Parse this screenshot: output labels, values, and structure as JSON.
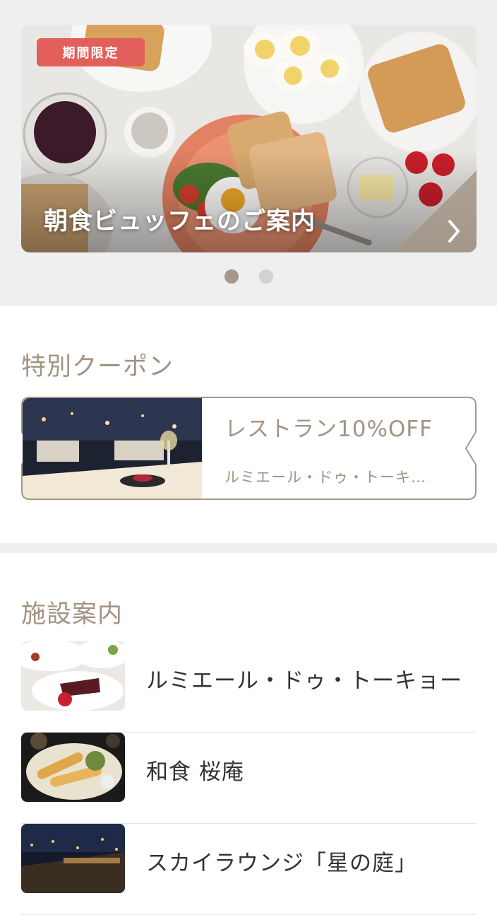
{
  "banner": {
    "badge": "期間限定",
    "title": "朝食ビュッフェのご案内",
    "arrow_icon": "chevron-right-icon",
    "slide_count": 2,
    "active_slide": 1
  },
  "coupon_section": {
    "title": "特別クーポン",
    "coupon": {
      "title": "レストラン10%OFF",
      "subtitle": "ルミエール・ドゥ・トーキ…"
    }
  },
  "facility_section": {
    "title": "施設案内",
    "items": [
      {
        "label": "ルミエール・ドゥ・トーキョー"
      },
      {
        "label": "和食 桜庵"
      },
      {
        "label": "スカイラウンジ「星の庭」"
      }
    ]
  },
  "colors": {
    "accent": "#a49382",
    "badge": "#e25f5b",
    "background_band": "#efefef"
  }
}
